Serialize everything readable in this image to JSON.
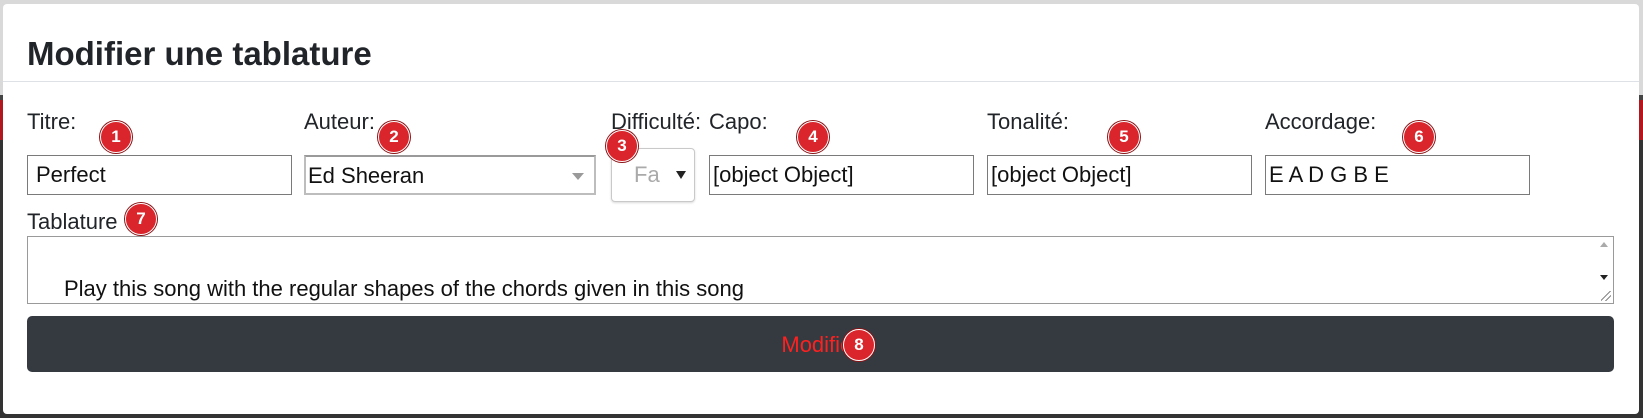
{
  "modal": {
    "title": "Modifier une tablature"
  },
  "form": {
    "titre": {
      "label": "Titre:",
      "value": "Perfect"
    },
    "auteur": {
      "label": "Auteur:",
      "value": "Ed Sheeran"
    },
    "difficulte": {
      "label": "Difficulté:",
      "value": "Fa"
    },
    "capo": {
      "label": "Capo:",
      "value": "[object Object]"
    },
    "tonalite": {
      "label": "Tonalité:",
      "value": "[object Object]"
    },
    "accordage": {
      "label": "Accordage:",
      "value": "E A D G B E"
    },
    "tablature": {
      "label": "Tablature",
      "value": "Play this song with the regular shapes of the chords given in this song"
    },
    "submit_label": "Modifier"
  },
  "badges": [
    "1",
    "2",
    "3",
    "4",
    "5",
    "6",
    "7",
    "8"
  ],
  "colors": {
    "button_bg": "#343a40",
    "button_text": "#ff2020",
    "badge": "#d9252b"
  }
}
